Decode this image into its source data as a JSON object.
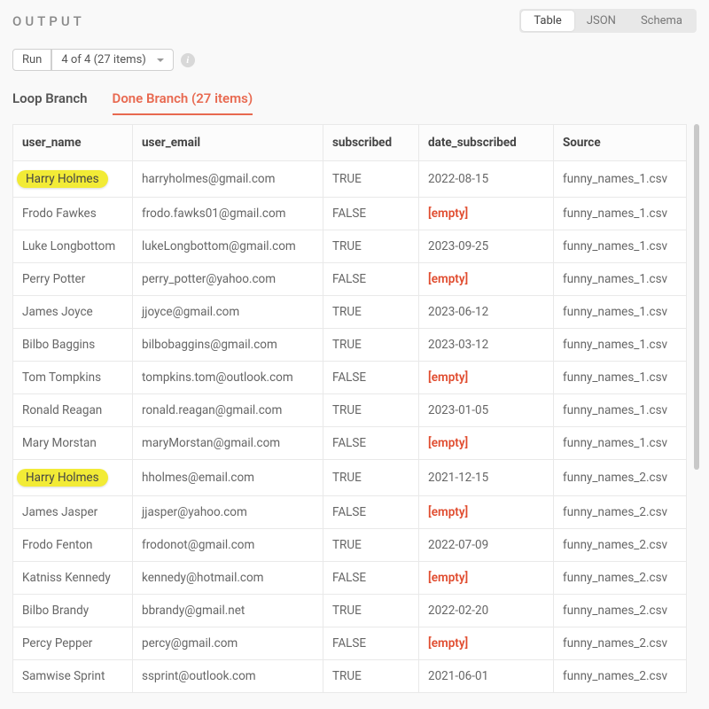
{
  "title": "OUTPUT",
  "view_tabs": {
    "table": "Table",
    "json": "JSON",
    "schema": "Schema"
  },
  "run": {
    "button": "Run",
    "select": "4 of 4 (27 items)"
  },
  "branch_tabs": {
    "loop": "Loop Branch",
    "done": "Done Branch (27 items)"
  },
  "columns": {
    "user_name": "user_name",
    "user_email": "user_email",
    "subscribed": "subscribed",
    "date_subscribed": "date_subscribed",
    "source": "Source"
  },
  "empty_label": "[empty]",
  "rows": [
    {
      "user_name": "Harry Holmes",
      "user_email": "harryholmes@gmail.com",
      "subscribed": "TRUE",
      "date_subscribed": "2022-08-15",
      "source": "funny_names_1.csv",
      "highlight": true
    },
    {
      "user_name": "Frodo Fawkes",
      "user_email": "frodo.fawks01@gmail.com",
      "subscribed": "FALSE",
      "date_subscribed": "",
      "source": "funny_names_1.csv"
    },
    {
      "user_name": "Luke Longbottom",
      "user_email": "lukeLongbottom@gmail.com",
      "subscribed": "TRUE",
      "date_subscribed": "2023-09-25",
      "source": "funny_names_1.csv"
    },
    {
      "user_name": "Perry Potter",
      "user_email": "perry_potter@yahoo.com",
      "subscribed": "FALSE",
      "date_subscribed": "",
      "source": "funny_names_1.csv"
    },
    {
      "user_name": "James Joyce",
      "user_email": "jjoyce@gmail.com",
      "subscribed": "TRUE",
      "date_subscribed": "2023-06-12",
      "source": "funny_names_1.csv"
    },
    {
      "user_name": "Bilbo Baggins",
      "user_email": "bilbobaggins@gmail.com",
      "subscribed": "TRUE",
      "date_subscribed": "2023-03-12",
      "source": "funny_names_1.csv"
    },
    {
      "user_name": "Tom Tompkins",
      "user_email": "tompkins.tom@outlook.com",
      "subscribed": "FALSE",
      "date_subscribed": "",
      "source": "funny_names_1.csv"
    },
    {
      "user_name": "Ronald Reagan",
      "user_email": "ronald.reagan@gmail.com",
      "subscribed": "TRUE",
      "date_subscribed": "2023-01-05",
      "source": "funny_names_1.csv"
    },
    {
      "user_name": "Mary Morstan",
      "user_email": "maryMorstan@gmail.com",
      "subscribed": "FALSE",
      "date_subscribed": "",
      "source": "funny_names_1.csv"
    },
    {
      "user_name": "Harry Holmes",
      "user_email": "hholmes@email.com",
      "subscribed": "TRUE",
      "date_subscribed": "2021-12-15",
      "source": "funny_names_2.csv",
      "highlight": true
    },
    {
      "user_name": "James Jasper",
      "user_email": "jjasper@yahoo.com",
      "subscribed": "FALSE",
      "date_subscribed": "",
      "source": "funny_names_2.csv"
    },
    {
      "user_name": "Frodo Fenton",
      "user_email": "frodonot@gmail.com",
      "subscribed": "TRUE",
      "date_subscribed": "2022-07-09",
      "source": "funny_names_2.csv"
    },
    {
      "user_name": "Katniss Kennedy",
      "user_email": "kennedy@hotmail.com",
      "subscribed": "FALSE",
      "date_subscribed": "",
      "source": "funny_names_2.csv"
    },
    {
      "user_name": "Bilbo Brandy",
      "user_email": "bbrandy@gmail.net",
      "subscribed": "TRUE",
      "date_subscribed": "2022-02-20",
      "source": "funny_names_2.csv"
    },
    {
      "user_name": "Percy Pepper",
      "user_email": "percy@gmail.com",
      "subscribed": "FALSE",
      "date_subscribed": "",
      "source": "funny_names_2.csv"
    },
    {
      "user_name": "Samwise Sprint",
      "user_email": "ssprint@outlook.com",
      "subscribed": "TRUE",
      "date_subscribed": "2021-06-01",
      "source": "funny_names_2.csv"
    }
  ]
}
